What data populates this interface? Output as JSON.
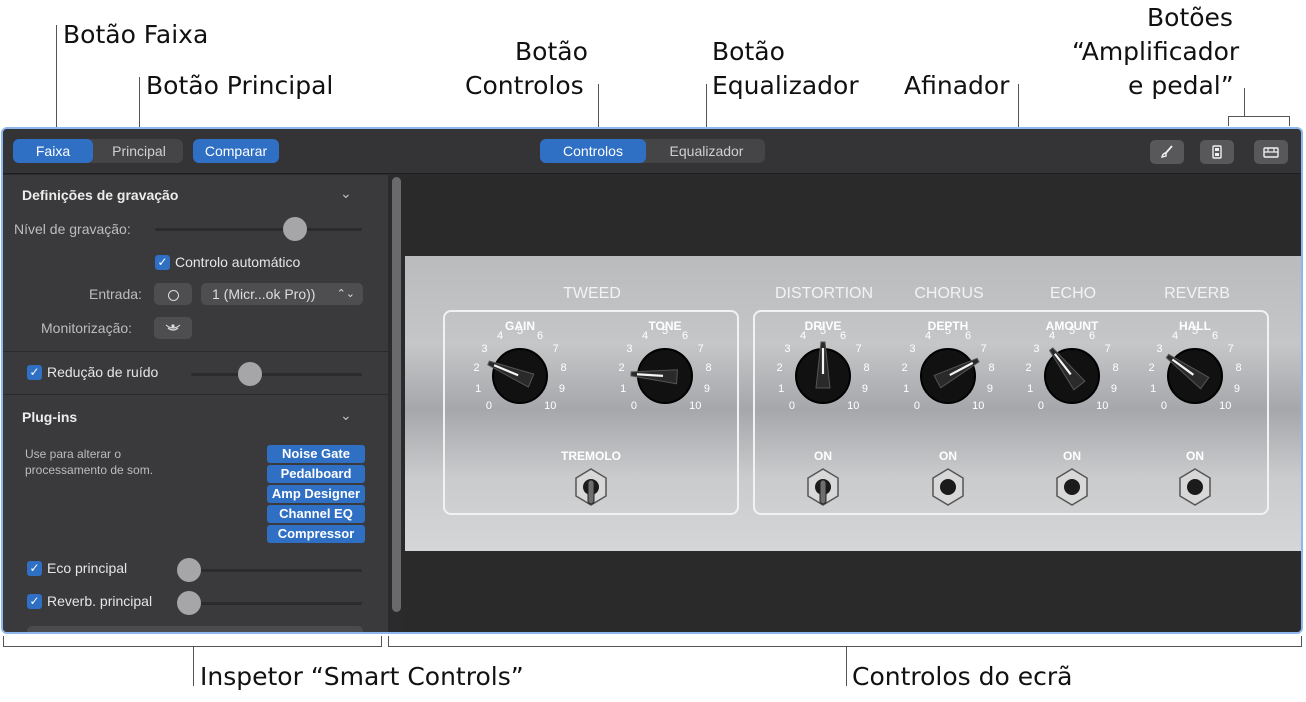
{
  "callouts": {
    "track_button": "Botão Faixa",
    "master_button": "Botão Principal",
    "controls_button_l1": "Botão",
    "controls_button_l2": "Controlos",
    "eq_button_l1": "Botão",
    "eq_button_l2": "Equalizador",
    "tuner": "Afinador",
    "amp_pedal_l1": "Botões",
    "amp_pedal_l2": "“Amplificador",
    "amp_pedal_l3": "e pedal”",
    "inspector": "Inspetor “Smart Controls”",
    "screen_controls": "Controlos do ecrã"
  },
  "toolbar": {
    "track_label": "Faixa",
    "master_label": "Principal",
    "compare_label": "Comparar",
    "controls_label": "Controlos",
    "eq_label": "Equalizador"
  },
  "inspector": {
    "recording_settings": "Definições de gravação",
    "recording_level_label": "Nível de gravação:",
    "recording_level": 0.7,
    "auto_control_label": "Controlo automático",
    "input_label": "Entrada:",
    "input_value": "1 (Micr...ok Pro))",
    "monitoring_label": "Monitorização:",
    "noise_reduction_label": "Redução de ruído",
    "noise_reduction_level": 0.32,
    "plugins_title": "Plug-ins",
    "plugins_desc_l1": "Use para alterar o",
    "plugins_desc_l2": "processamento de som.",
    "plugins": [
      "Noise Gate",
      "Pedalboard",
      "Amp Designer",
      "Channel EQ",
      "Compressor"
    ],
    "master_echo_label": "Eco principal",
    "master_echo_level": 0.0,
    "master_reverb_label": "Reverb. principal",
    "master_reverb_level": 0.0
  },
  "screen": {
    "sections": [
      "TWEED",
      "DISTORTION",
      "CHORUS",
      "ECHO",
      "REVERB"
    ],
    "knobs": [
      {
        "label": "GAIN",
        "value": 2.5
      },
      {
        "label": "TONE",
        "value": 1.8
      },
      {
        "label": "DRIVE",
        "value": 5.0
      },
      {
        "label": "DEPTH",
        "value": 7.3
      },
      {
        "label": "AMOUNT",
        "value": 3.6
      },
      {
        "label": "HALL",
        "value": 3.0
      }
    ],
    "scale": [
      "0",
      "1",
      "2",
      "3",
      "4",
      "5",
      "6",
      "7",
      "8",
      "9",
      "10"
    ],
    "switches": [
      "TREMOLO",
      "ON",
      "ON",
      "ON",
      "ON"
    ]
  },
  "colors": {
    "accent": "#2f6fc4",
    "callout_frame": "#8db8ee"
  }
}
